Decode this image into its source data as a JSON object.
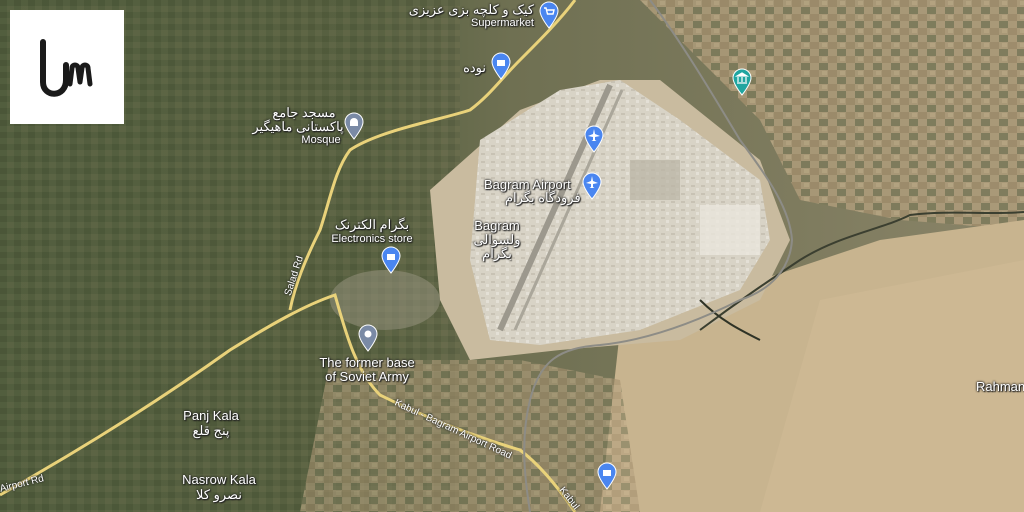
{
  "logo": {
    "icon": "um-logo-icon"
  },
  "places": {
    "supermarket_name": "کیک و کلچه بزی عزیزی",
    "supermarket_type": "Supermarket",
    "store_nawda": "نوده",
    "mosque_name_1": "مسجد جامع",
    "mosque_name_2": "پاکستانی ماهیگیر",
    "mosque_type": "Mosque",
    "airport_name": "Bagram Airport",
    "airport_name_fa": "فرودگاه بگرام",
    "district_name": "Bagram",
    "district_name_fa_1": "ولسوالی",
    "district_name_fa_2": "بگرام",
    "electronics_name": "بگرام الکترنک",
    "electronics_type": "Electronics store",
    "soviet_base_1": "The former base",
    "soviet_base_2": "of Soviet Army",
    "panj_kala": "Panj Kala",
    "panj_kala_fa": "پنج قلع",
    "nasrow_kala": "Nasrow Kala",
    "nasrow_kala_fa": "نصرو کلا",
    "rahman": "Rahman"
  },
  "roads": {
    "salad_rd": "Salad Rd",
    "kabul_bagram_rd": "Kabul - Bagram Airport Road",
    "kabul_short": "Kabul",
    "airport_rd": "Airport Rd"
  },
  "colors": {
    "pin_blue": "#4a86f0",
    "pin_grey": "#7a8aa5",
    "pin_teal": "#1fa5a0",
    "road_yellow": "#e9d27a"
  }
}
